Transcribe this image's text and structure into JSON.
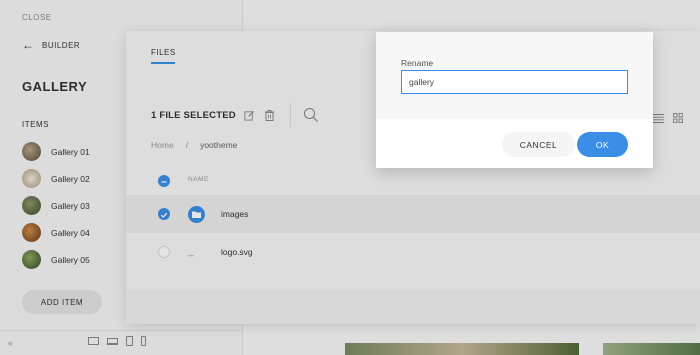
{
  "sidebar": {
    "close_label": "CLOSE",
    "back_label": "BUILDER",
    "title": "GALLERY",
    "items_heading": "ITEMS",
    "items": [
      {
        "label": "Gallery 01"
      },
      {
        "label": "Gallery 02"
      },
      {
        "label": "Gallery 03"
      },
      {
        "label": "Gallery 04"
      },
      {
        "label": "Gallery 05"
      }
    ],
    "add_item_label": "ADD ITEM",
    "collapse_icon": "double-chevron-left-icon",
    "device_icons": [
      "desktop-icon",
      "laptop-icon",
      "tablet-icon",
      "phone-icon"
    ]
  },
  "modal": {
    "tab_label": "FILES",
    "selection_count": "1 FILE SELECTED",
    "breadcrumb": [
      "Home",
      "/",
      "yootheme"
    ],
    "name_header": "NAME",
    "files": [
      {
        "name": "images",
        "type": "folder",
        "selected": true
      },
      {
        "name": "logo.svg",
        "type": "file",
        "selected": false
      }
    ],
    "file_dash": "---"
  },
  "dialog": {
    "label": "Rename",
    "input_value": "gallery",
    "cancel_label": "CANCEL",
    "ok_label": "OK"
  },
  "colors": {
    "accent": "#3a8ee6",
    "sidebar_bg": "#f5f5f5",
    "modal_bg": "#f6f6f6"
  }
}
